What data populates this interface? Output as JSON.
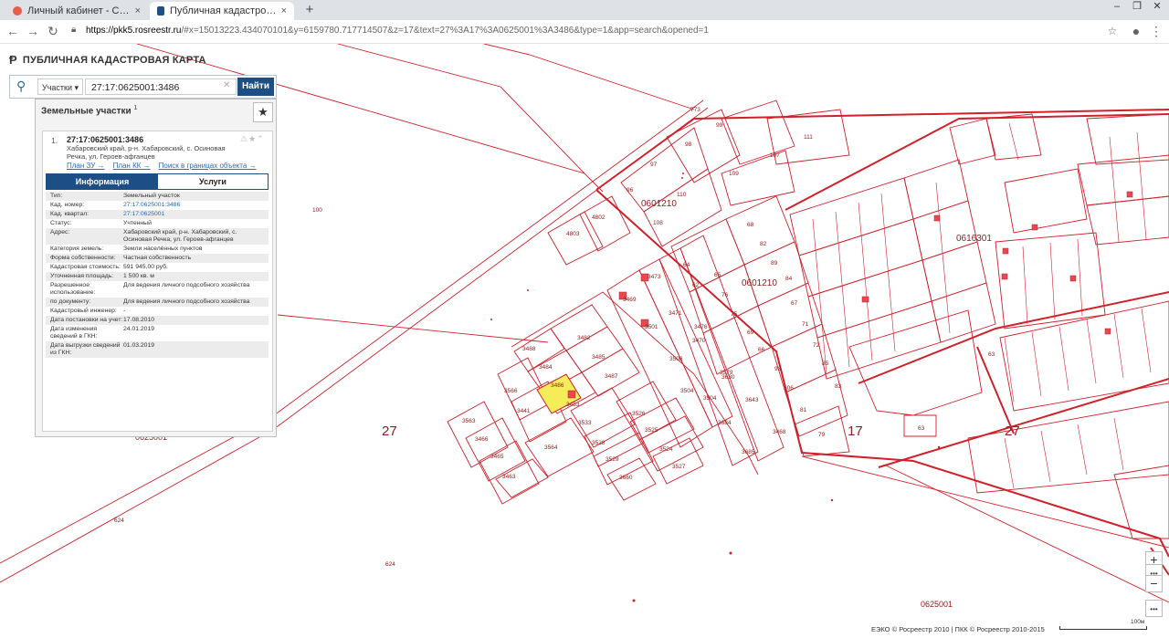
{
  "browser": {
    "tabs": [
      {
        "title": "Личный кабинет - Сообщения",
        "active": false,
        "icon": "opera-icon",
        "color": "#e85c4c"
      },
      {
        "title": "Публичная кадастровая карта",
        "active": true,
        "icon": "rosreestr-icon"
      }
    ],
    "new_tab": "+",
    "close": "×",
    "url_host": "https://pkk5.rosreestr.ru",
    "url_rest": "/#x=15013223.434070101&y=6159780.717714507&z=17&text=27%3A17%3A0625001%3A3486&type=1&app=search&opened=1"
  },
  "app": {
    "title": "ПУБЛИЧНАЯ КАДАСТРОВАЯ КАРТА",
    "search": {
      "type_label": "Участки",
      "value": "27:17:0625001:3486",
      "button": "Найти"
    },
    "panel": {
      "title": "Земельные участки",
      "count": "1",
      "item": {
        "index": "1.",
        "number": "27:17:0625001:3486",
        "address": "Хабаровский край, р-н. Хабаровский, с. Осиновая Речка, ул. Героев-афганцев",
        "links": [
          "План ЗУ →",
          "План КК →",
          "Поиск в границах объекта →"
        ],
        "tabs": [
          "Информация",
          "Услуги"
        ],
        "info": [
          {
            "k": "Тип:",
            "v": "Земельный участок"
          },
          {
            "k": "Кад. номер:",
            "v": "27:17:0625001:3486",
            "link": true
          },
          {
            "k": "Кад. квартал:",
            "v": "27:17:0625001",
            "link": true
          },
          {
            "k": "Статус:",
            "v": "Учтенный"
          },
          {
            "k": "Адрес:",
            "v": "Хабаровский край, р-н. Хабаровский, с. Осиновая Речка, ул. Героев-афганцев"
          },
          {
            "k": "Категория земель:",
            "v": "Земли населённых пунктов"
          },
          {
            "k": "Форма собственности:",
            "v": "Частная собственность"
          },
          {
            "k": "Кадастровая стоимость:",
            "v": "591 945,00 руб."
          },
          {
            "k": "Уточненная площадь:",
            "v": "1 500 кв. м"
          },
          {
            "k": "Разрешенное использование:",
            "v": "Для ведения личного подсобного хозяйства"
          },
          {
            "k": "по документу:",
            "v": "Для ведения личного подсобного хозяйства"
          },
          {
            "k": "Кадастровый инженер:",
            "v": "-"
          },
          {
            "k": "Дата постановки на учет:",
            "v": "17.08.2010"
          },
          {
            "k": "Дата изменения сведений в ГКН:",
            "v": "24.01.2019"
          },
          {
            "k": "Дата выгрузки сведений из ГКН:",
            "v": "01.03.2019"
          }
        ]
      }
    },
    "attribution": "ЕЭКО © Росреестр 2010 | ПКК © Росреестр 2010-2015",
    "scale_label": "100м",
    "zoom_in": "+",
    "zoom_out": "−",
    "more": "•••"
  },
  "map": {
    "line_color": "#d0202a",
    "highlight_color": "#f5ec5a",
    "quarter_labels": [
      "27",
      "17",
      "27",
      "0601210",
      "0601210",
      "0616301",
      "0625001",
      "0625001"
    ],
    "plot_labels": [
      "3488",
      "3482",
      "3485",
      "3484",
      "3487",
      "3486",
      "3483",
      "3566",
      "3441",
      "3563",
      "3466",
      "3465",
      "3463",
      "3564",
      "3533",
      "3528",
      "3529",
      "3660",
      "3526",
      "3525",
      "3524",
      "3527",
      "3506",
      "3504",
      "3504",
      "3684",
      "3685",
      "3470",
      "3476",
      "3579",
      "3643",
      "3468",
      "3473",
      "3471",
      "3469",
      "3501",
      "3630",
      "624",
      "624",
      "773",
      "100",
      "99",
      "98",
      "97",
      "96",
      "110",
      "108",
      "109",
      "107",
      "111",
      "4803",
      "4802",
      "68",
      "64",
      "65",
      "82",
      "89",
      "62",
      "76",
      "84",
      "75",
      "67",
      "69",
      "71",
      "66",
      "72",
      "93",
      "85",
      "106",
      "83",
      "81",
      "79",
      "63",
      "63"
    ]
  }
}
